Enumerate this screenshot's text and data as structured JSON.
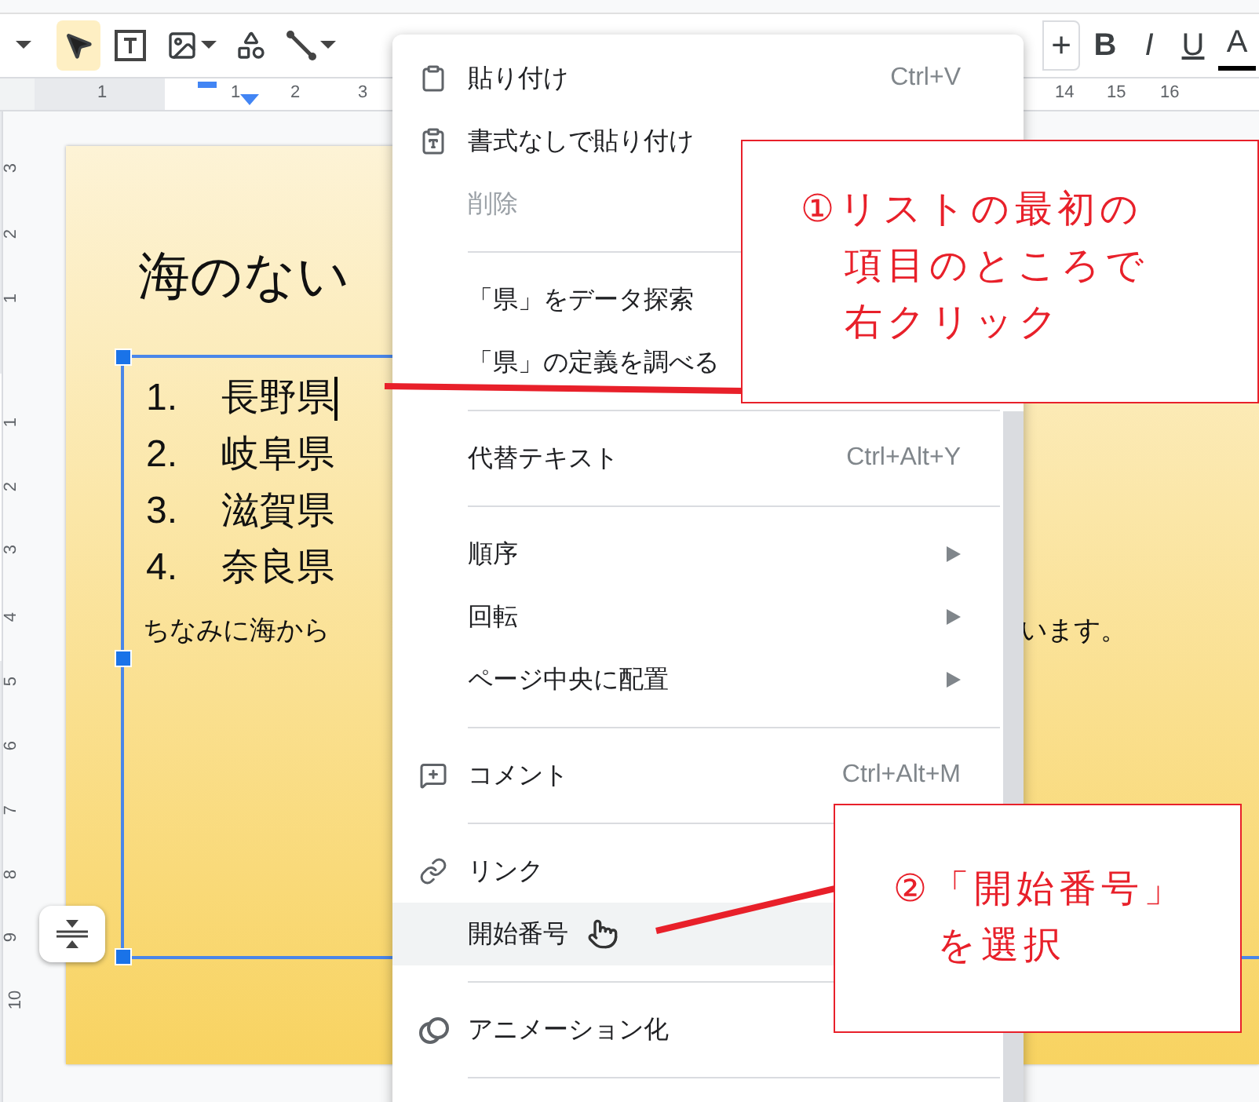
{
  "toolbar": {
    "tools": [
      {
        "kind": "menu_caret",
        "selected": false
      },
      {
        "kind": "select",
        "selected": true
      },
      {
        "kind": "textbox",
        "selected": false
      },
      {
        "kind": "image",
        "selected": false
      },
      {
        "kind": "shape",
        "selected": false
      },
      {
        "kind": "line",
        "selected": false
      }
    ],
    "format_buttons": [
      {
        "kind": "plus",
        "label": "+"
      },
      {
        "kind": "bold",
        "label": "B"
      },
      {
        "kind": "italic",
        "label": "I"
      },
      {
        "kind": "underline",
        "label": "U"
      },
      {
        "kind": "color",
        "label": "A"
      }
    ]
  },
  "ruler": {
    "horizontal": [
      "1",
      "1",
      "2",
      "3",
      "14",
      "15",
      "16"
    ],
    "vertical": [
      "3",
      "2",
      "1",
      "1",
      "2",
      "3",
      "4",
      "5",
      "6",
      "7",
      "8",
      "9",
      "10"
    ]
  },
  "slide": {
    "title": "海のない",
    "list": [
      {
        "number": "1.",
        "text": "長野県",
        "cursor": true
      },
      {
        "number": "2.",
        "text": "岐阜県",
        "cursor": false
      },
      {
        "number": "3.",
        "text": "滋賀県",
        "cursor": false
      },
      {
        "number": "4.",
        "text": "奈良県",
        "cursor": false
      }
    ],
    "note_start": "ちなみに海から",
    "note_end": "います。"
  },
  "context_menu": {
    "groups": [
      [
        {
          "kind": "paste",
          "label": "貼り付け",
          "shortcut": "Ctrl+V",
          "disabled": false,
          "selected": false
        },
        {
          "kind": "paste_plain",
          "label": "書式なしで貼り付け",
          "disabled": false,
          "selected": false
        },
        {
          "kind": "plain",
          "label": "削除",
          "disabled": true,
          "selected": false
        }
      ],
      [
        {
          "kind": "plain",
          "label": "「県」をデータ探索",
          "disabled": false,
          "selected": false
        },
        {
          "kind": "plain",
          "label": "「県」の定義を調べる",
          "disabled": false,
          "selected": false
        }
      ],
      [
        {
          "kind": "plain",
          "label": "代替テキスト",
          "shortcut": "Ctrl+Alt+Y",
          "disabled": false,
          "selected": false
        }
      ],
      [
        {
          "kind": "submenu",
          "label": "順序",
          "disabled": false,
          "selected": false
        },
        {
          "kind": "submenu",
          "label": "回転",
          "disabled": false,
          "selected": false
        },
        {
          "kind": "submenu",
          "label": "ページ中央に配置",
          "disabled": false,
          "selected": false
        }
      ],
      [
        {
          "kind": "comment",
          "label": "コメント",
          "shortcut": "Ctrl+Alt+M",
          "disabled": false,
          "selected": false
        }
      ],
      [
        {
          "kind": "link",
          "label": "リンク",
          "disabled": false,
          "selected": false
        },
        {
          "kind": "plain",
          "label": "開始番号",
          "disabled": false,
          "selected": true
        }
      ],
      [
        {
          "kind": "animation",
          "label": "アニメーション化",
          "disabled": false,
          "selected": false
        }
      ]
    ]
  },
  "callouts": [
    {
      "lines": [
        "①リストの最初の",
        "項目のところで",
        "右クリック"
      ]
    },
    {
      "lines": [
        "②「開始番号」",
        "を選択"
      ]
    }
  ]
}
